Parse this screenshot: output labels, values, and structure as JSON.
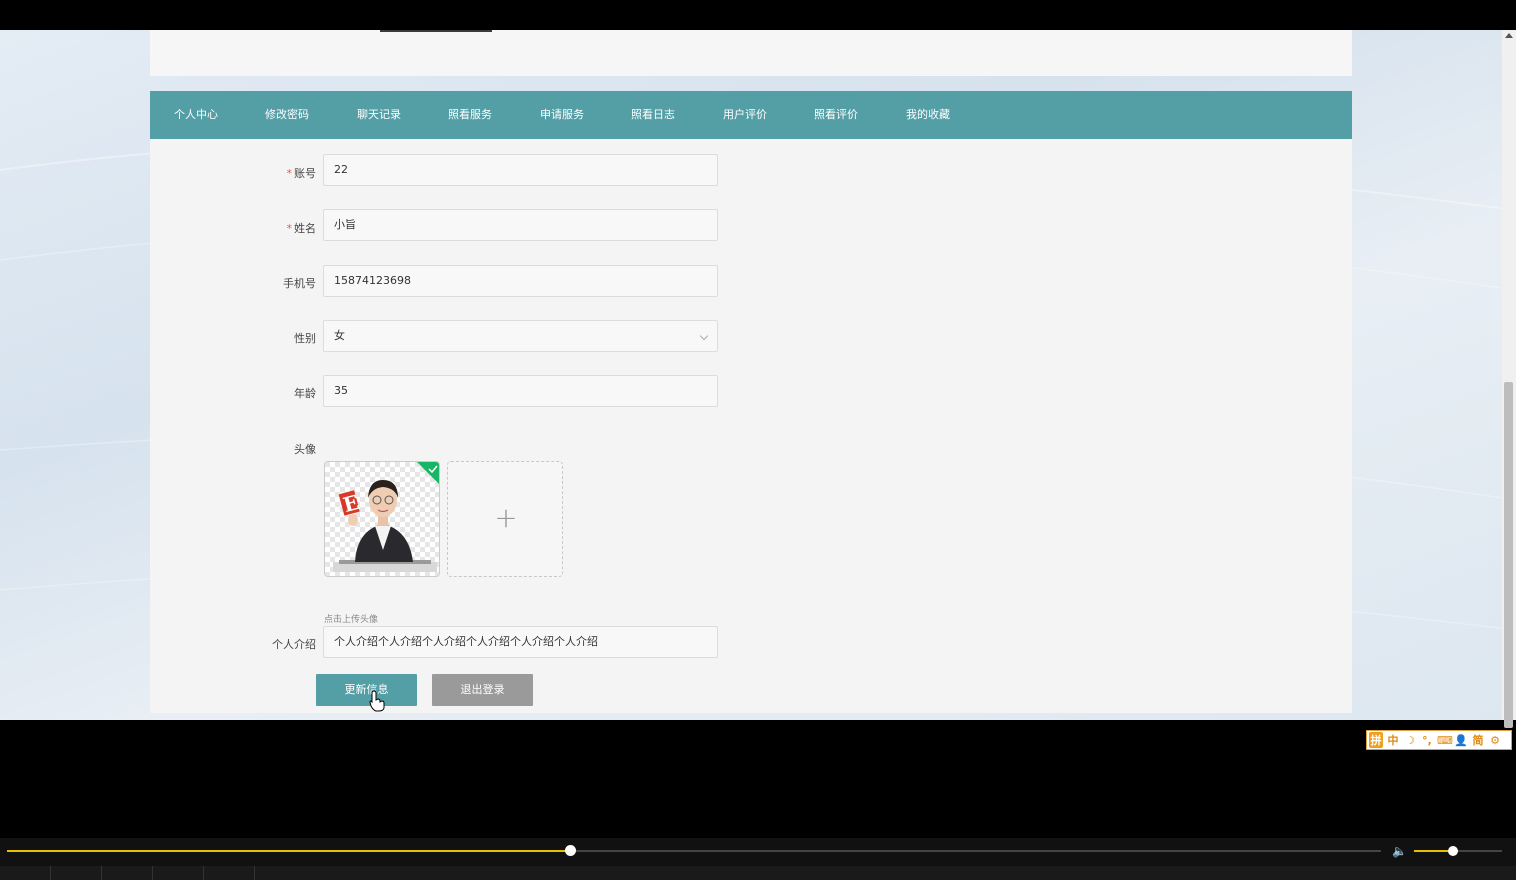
{
  "navbar": {
    "items": [
      "个人中心",
      "修改密码",
      "聊天记录",
      "照看服务",
      "申请服务",
      "照看日志",
      "用户评价",
      "照看评价",
      "我的收藏"
    ]
  },
  "form": {
    "account": {
      "label": "账号",
      "value": "22",
      "required": true
    },
    "name": {
      "label": "姓名",
      "value": "小旨",
      "required": true
    },
    "phone": {
      "label": "手机号",
      "value": "15874123698"
    },
    "gender": {
      "label": "性别",
      "value": "女"
    },
    "age": {
      "label": "年龄",
      "value": "35"
    },
    "avatar": {
      "label": "头像",
      "hint": "点击上传头像",
      "upload_symbol": "+"
    },
    "intro": {
      "label": "个人介绍",
      "value": "个人介绍个人介绍个人介绍个人介绍个人介绍个人介绍"
    },
    "required_mark": "*"
  },
  "buttons": {
    "update": "更新信息",
    "logout": "退出登录"
  },
  "ime": {
    "items": [
      "拼",
      "中",
      "☽",
      "°,",
      "⌨",
      "👤",
      "简",
      "⚙"
    ]
  },
  "player": {
    "progress": 0.41,
    "volume": 0.44
  },
  "colors": {
    "nav": "#549ea6",
    "update_button": "#549ea6",
    "logout_button": "#9a9a9a",
    "progress": "#e6c000"
  }
}
